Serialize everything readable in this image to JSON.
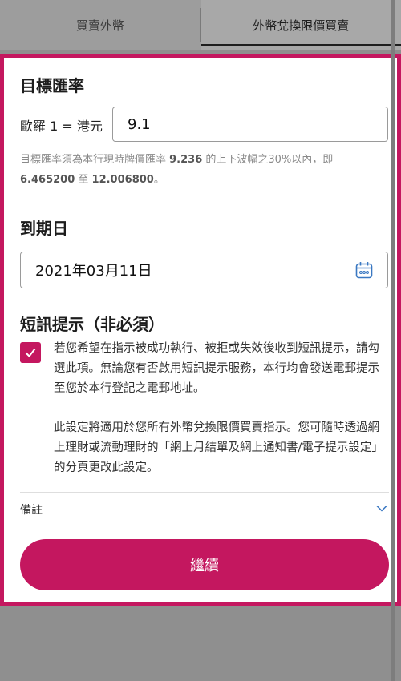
{
  "tabs": [
    {
      "label": "買賣外幣"
    },
    {
      "label": "外幣兌換限價買賣"
    }
  ],
  "target_rate": {
    "title": "目標匯率",
    "label": "歐羅 1 = 港元",
    "value": "9.1",
    "hint_prefix": "目標匯率須為本行現時牌價匯率 ",
    "hint_rate": "9.236",
    "hint_mid": " 的上下波幅之30%以內，即 ",
    "hint_low": "6.465200",
    "hint_to": " 至 ",
    "hint_high": "12.006800",
    "hint_end": "。"
  },
  "expiry": {
    "title": "到期日",
    "value": "2021年03月11日",
    "icon": "calendar-icon"
  },
  "sms": {
    "title": "短訊提示（非必須）",
    "checked": true,
    "paragraph1": "若您希望在指示被成功執行、被拒或失效後收到短訊提示，請勾選此項。無論您有否啟用短訊提示服務，本行均會發送電郵提示至您於本行登記之電郵地址。",
    "paragraph2": "此設定將適用於您所有外幣兌換限價買賣指示。您可隨時透過網上理財或流動理財的「網上月結單及網上通知書/電子提示設定」的分頁更改此設定。"
  },
  "remarks": {
    "label": "備註"
  },
  "continue_button": {
    "label": "繼續"
  },
  "colors": {
    "accent": "#c4175f"
  }
}
